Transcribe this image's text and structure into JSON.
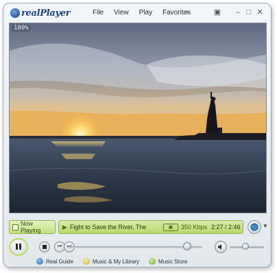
{
  "app": {
    "logo_text": "realPlayer"
  },
  "menu": {
    "items": [
      "File",
      "View",
      "Play",
      "Favorites"
    ]
  },
  "video": {
    "zoom_readout": "100%"
  },
  "now_playing": {
    "tab_label": "Now Playing",
    "clip_title": "Fight to Save the River, The",
    "bitrate": "350 Kbps",
    "time": "2:27 / 2:46"
  },
  "playback": {
    "position_fraction": 0.89,
    "volume_fraction": 0.46
  },
  "links": {
    "real_guide": "Real Guide",
    "music_library": "Music & My Library",
    "music_store": "Music Store"
  },
  "colors": {
    "accent_green": "#b8d96c",
    "logo_blue": "#1a3f86"
  },
  "icons": [
    "realplayer-logo-icon",
    "pip-icon",
    "minimize-icon",
    "maximize-icon",
    "close-icon",
    "globe-icon",
    "pause-icon",
    "stop-icon",
    "previous-icon",
    "next-icon",
    "volume-icon"
  ]
}
